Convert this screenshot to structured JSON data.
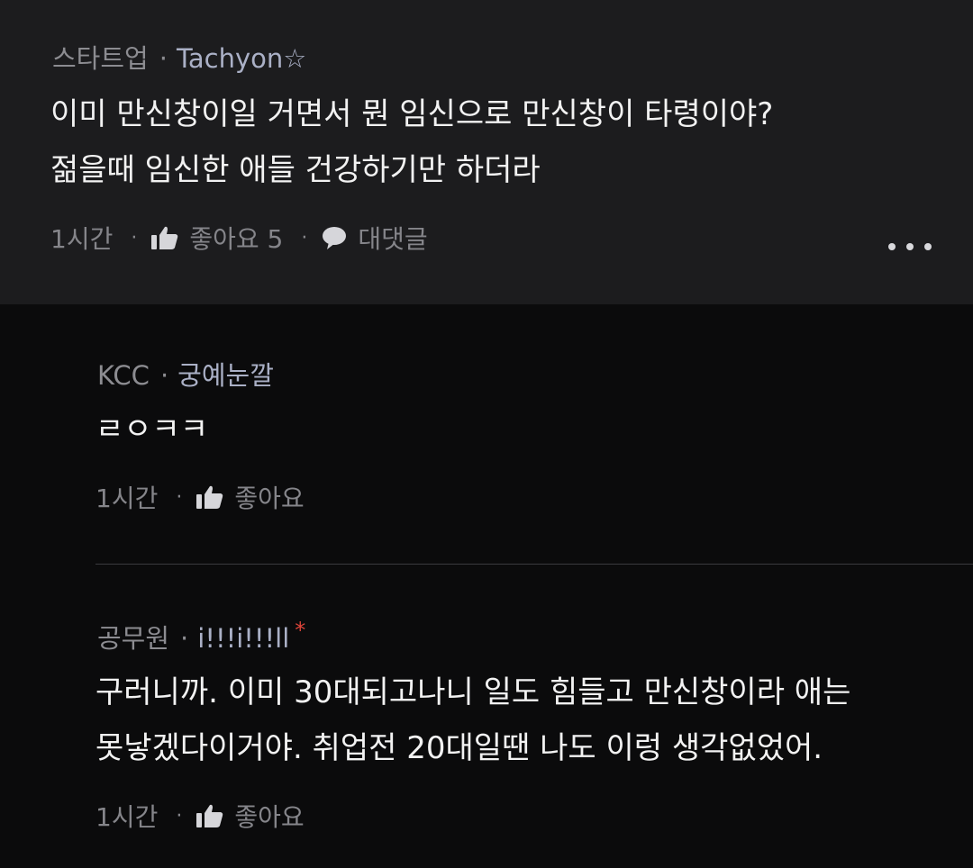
{
  "comments": [
    {
      "category": "스타트업",
      "nickname": "Tachyon☆",
      "lines": [
        "이미 만신창이일 거면서 뭔 임신으로 만신창이 타령이야?",
        "젊을때 임신한 애들 건강하기만 하더라"
      ],
      "time": "1시간",
      "like_label": "좋아요 5",
      "reply_label": "대댓글"
    },
    {
      "category": "KCC",
      "nickname": "궁예눈깔",
      "lines": [
        "ㄹㅇㅋㅋ"
      ],
      "time": "1시간",
      "like_label": "좋아요"
    },
    {
      "category": "공무원",
      "nickname": "i!!!i!!!ll",
      "badge": "*",
      "lines": [
        "구러니까. 이미 30대되고나니 일도 힘들고 만신창이라 애는",
        "못낳겠다이거야. 취업전 20대일땐 나도 이렁 생각없었어."
      ],
      "time": "1시간",
      "like_label": "좋아요"
    }
  ],
  "icons": {
    "like": "thumbs-up-icon",
    "reply": "speech-bubble-icon",
    "more": "more-dots-icon"
  },
  "colors": {
    "top_background": "#1c1c1e",
    "page_background": "#0b0b0c",
    "badge": "#e0453a"
  }
}
